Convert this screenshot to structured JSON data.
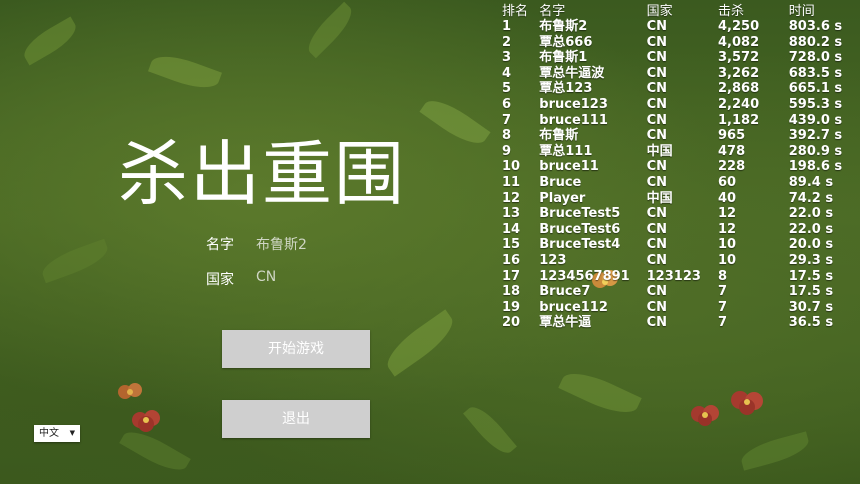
{
  "title": "杀出重围",
  "form": {
    "name_label": "名字",
    "name_value": "布鲁斯2",
    "country_label": "国家",
    "country_value": "CN"
  },
  "buttons": {
    "start": "开始游戏",
    "exit": "退出"
  },
  "language": {
    "selected": "中文"
  },
  "leaderboard": {
    "headers": {
      "rank": "排名",
      "name": "名字",
      "country": "国家",
      "kills": "击杀",
      "time": "时间"
    },
    "rows": [
      {
        "rank": "1",
        "name": "布鲁斯2",
        "country": "CN",
        "kills": "4,250",
        "time": "803.6 s"
      },
      {
        "rank": "2",
        "name": "覃总666",
        "country": "CN",
        "kills": "4,082",
        "time": "880.2 s"
      },
      {
        "rank": "3",
        "name": "布鲁斯1",
        "country": "CN",
        "kills": "3,572",
        "time": "728.0 s"
      },
      {
        "rank": "4",
        "name": "覃总牛逼波",
        "country": "CN",
        "kills": "3,262",
        "time": "683.5 s"
      },
      {
        "rank": "5",
        "name": "覃总123",
        "country": "CN",
        "kills": "2,868",
        "time": "665.1 s"
      },
      {
        "rank": "6",
        "name": "bruce123",
        "country": "CN",
        "kills": "2,240",
        "time": "595.3 s"
      },
      {
        "rank": "7",
        "name": "bruce111",
        "country": "CN",
        "kills": "1,182",
        "time": "439.0 s"
      },
      {
        "rank": "8",
        "name": "布鲁斯",
        "country": "CN",
        "kills": "965",
        "time": "392.7 s"
      },
      {
        "rank": "9",
        "name": "覃总111",
        "country": "中国",
        "kills": "478",
        "time": "280.9 s"
      },
      {
        "rank": "10",
        "name": "bruce11",
        "country": "CN",
        "kills": "228",
        "time": "198.6 s"
      },
      {
        "rank": "11",
        "name": "Bruce",
        "country": "CN",
        "kills": "60",
        "time": "89.4 s"
      },
      {
        "rank": "12",
        "name": "Player",
        "country": "中国",
        "kills": "40",
        "time": "74.2 s"
      },
      {
        "rank": "13",
        "name": "BruceTest5",
        "country": "CN",
        "kills": "12",
        "time": "22.0 s"
      },
      {
        "rank": "14",
        "name": "BruceTest6",
        "country": "CN",
        "kills": "12",
        "time": "22.0 s"
      },
      {
        "rank": "15",
        "name": "BruceTest4",
        "country": "CN",
        "kills": "10",
        "time": "20.0 s"
      },
      {
        "rank": "16",
        "name": "123",
        "country": "CN",
        "kills": "10",
        "time": "29.3 s"
      },
      {
        "rank": "17",
        "name": "1234567891",
        "country": "123123",
        "kills": "8",
        "time": "17.5 s"
      },
      {
        "rank": "18",
        "name": "Bruce7",
        "country": "CN",
        "kills": "7",
        "time": "17.5 s"
      },
      {
        "rank": "19",
        "name": "bruce112",
        "country": "CN",
        "kills": "7",
        "time": "30.7 s"
      },
      {
        "rank": "20",
        "name": "覃总牛逼",
        "country": "CN",
        "kills": "7",
        "time": "36.5 s"
      }
    ]
  },
  "colors": {
    "background": "#4a6a24",
    "button": "#cfcfcf",
    "text": "#ffffff"
  }
}
